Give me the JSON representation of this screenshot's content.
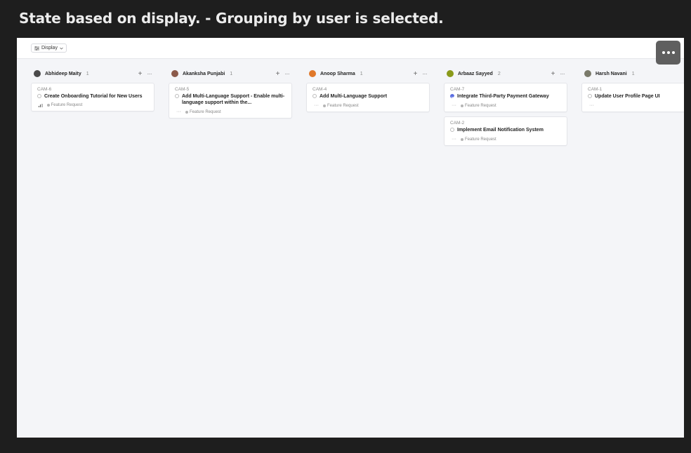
{
  "caption": "State based on display. - Grouping by user is selected.",
  "toolbar": {
    "display_label": "Display"
  },
  "columns": [
    {
      "name": "Abhideep Maity",
      "count": "1",
      "avatar_color": "#4a4a4a",
      "cards": [
        {
          "id": "CAM-6",
          "title": "Create Onboarding Tutorial for New Users",
          "status": "todo",
          "priority": "medium",
          "label": "Feature Request"
        }
      ]
    },
    {
      "name": "Akanksha Punjabi",
      "count": "1",
      "avatar_color": "#8b5a4a",
      "cards": [
        {
          "id": "CAM-5",
          "title": "Add Multi-Language Support - Enable multi-language support within the...",
          "status": "todo",
          "priority": "none",
          "label": "Feature Request"
        }
      ]
    },
    {
      "name": "Anoop Sharma",
      "count": "1",
      "avatar_color": "#e0782a",
      "cards": [
        {
          "id": "CAM-4",
          "title": "Add Multi-Language Support",
          "status": "todo",
          "priority": "none",
          "label": "Feature Request"
        }
      ]
    },
    {
      "name": "Arbaaz Sayyed",
      "count": "2",
      "avatar_color": "#8a9a1a",
      "cards": [
        {
          "id": "CAM-7",
          "title": "Integrate Third-Party Payment Gateway",
          "status": "done",
          "priority": "none",
          "label": "Feature Request"
        },
        {
          "id": "CAM-2",
          "title": "Implement Email Notification System",
          "status": "todo",
          "priority": "none",
          "label": "Feature Request"
        }
      ]
    },
    {
      "name": "Harsh Navani",
      "count": "1",
      "avatar_color": "#7a7a6a",
      "cards": [
        {
          "id": "CAM-1",
          "title": "Update User Profile Page UI",
          "status": "todo",
          "priority": "none",
          "label": ""
        }
      ]
    }
  ],
  "colors": {
    "done_status": "#5b6ee1",
    "board_bg": "#f4f5f8",
    "page_bg": "#1e1e1e"
  }
}
